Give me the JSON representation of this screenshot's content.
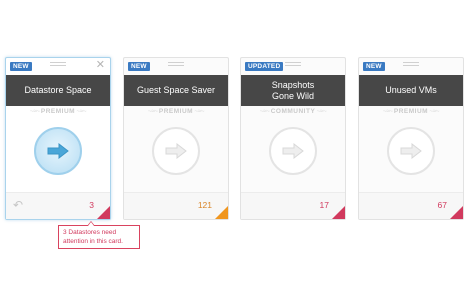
{
  "cards": [
    {
      "badge": "NEW",
      "title": "Datastore Space",
      "tier": "PREMIUM",
      "count": "3",
      "count_color": "#d13a5e",
      "corner_color": "#d13a5e",
      "active": true
    },
    {
      "badge": "NEW",
      "title": "Guest Space Saver",
      "tier": "PREMIUM",
      "count": "121",
      "count_color": "#d9862a",
      "corner_color": "#f0961f",
      "active": false
    },
    {
      "badge": "UPDATED",
      "title": "Snapshots\nGone Wild",
      "tier": "COMMUNITY",
      "count": "17",
      "count_color": "#d13a5e",
      "corner_color": "#d13a5e",
      "active": false
    },
    {
      "badge": "NEW",
      "title": "Unused VMs",
      "tier": "PREMIUM",
      "count": "67",
      "count_color": "#d13a5e",
      "corner_color": "#d13a5e",
      "active": false
    }
  ],
  "tooltip": {
    "text": "3 Datastores need attention in this card."
  },
  "colors": {
    "badge": "#3a7ac2",
    "title_bar": "#474747",
    "alert": "#d13a5e",
    "warning": "#f0961f",
    "active_border": "#a9d3ec"
  }
}
